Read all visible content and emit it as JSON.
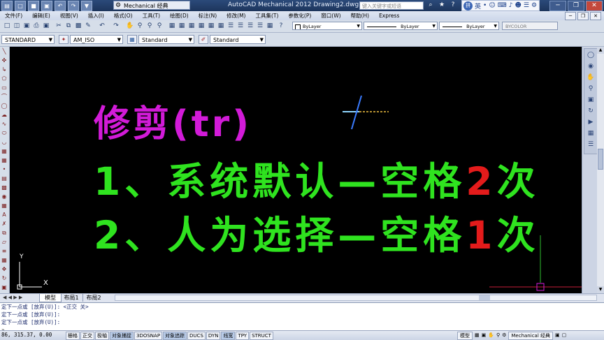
{
  "titlebar": {
    "quick_access": [
      "▤",
      "□",
      "■",
      "▣",
      "↶",
      "↷",
      "▼"
    ],
    "workspace": "Mechanical 经典",
    "app_title": "AutoCAD Mechanical 2012    Drawing2.dwg",
    "search_placeholder": "键入关键字或短语",
    "title_tools": [
      "⌕",
      "★",
      "?"
    ],
    "ime": {
      "logo": "拼",
      "items": [
        "英",
        "•",
        "☺",
        "⌨",
        "♪",
        "☻",
        "☰",
        "⚙"
      ]
    },
    "window_controls": [
      "─",
      "❐",
      "✕"
    ]
  },
  "menubar": {
    "items": [
      "文件(F)",
      "编辑(E)",
      "视图(V)",
      "插入(I)",
      "格式(O)",
      "工具(T)",
      "绘图(D)",
      "标注(N)",
      "修改(M)",
      "工具集(T)",
      "参数化(P)",
      "窗口(W)",
      "帮助(H)",
      "Express"
    ],
    "doc_controls": [
      "─",
      "❐",
      "✕"
    ]
  },
  "toolbar1": {
    "layer_color": "ByLayer",
    "linetype": "ByLayer",
    "lineweight": "ByLayer",
    "plotstyle": "BYCOLOR"
  },
  "toolbar2": {
    "text_style": "STANDARD",
    "dim_style": "AM_ISO",
    "table_style": "Standard",
    "mleader_style": "Standard"
  },
  "canvas": {
    "title": "修剪(tr)",
    "line1_prefix": "1、系统默认—空格",
    "line1_count": "2",
    "line1_suffix": "次",
    "line2_prefix": "2、人为选择—空格",
    "line2_count": "1",
    "line2_suffix": "次",
    "ucs_y": "Y",
    "ucs_x": "X",
    "colors": {
      "title": "#d21bd8",
      "body": "#2fe31f",
      "count": "#e41b1b",
      "background": "#000000"
    }
  },
  "tabs": {
    "nav": "◀ ◀ ▶ ▶",
    "model": "模型",
    "layout1": "布局1",
    "layout2": "布局2"
  },
  "command": {
    "history": [
      "定下一点或 [放弃(U)]: <正交 关>",
      "定下一点或 [放弃(U)]:",
      "定下一点或 [放弃(U)]:"
    ],
    "prompt": "»"
  },
  "status": {
    "coords": "86, 315.37, 0.00",
    "toggles": [
      {
        "label": "栅格",
        "on": false
      },
      {
        "label": "正交",
        "on": false
      },
      {
        "label": "极轴",
        "on": false
      },
      {
        "label": "对象捕捉",
        "on": true
      },
      {
        "label": "3DOSNAP",
        "on": false
      },
      {
        "label": "对象追踪",
        "on": true
      },
      {
        "label": "DUCS",
        "on": false
      },
      {
        "label": "DYN",
        "on": false
      },
      {
        "label": "线宽",
        "on": true
      },
      {
        "label": "TPY",
        "on": false
      },
      {
        "label": "STRUCT",
        "on": false
      }
    ],
    "right_model": "模型",
    "right_workspace": "Mechanical 经典"
  }
}
